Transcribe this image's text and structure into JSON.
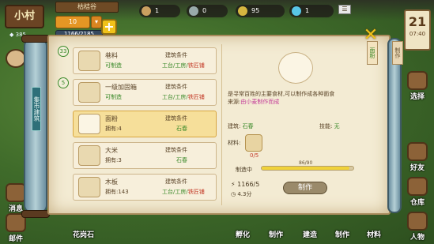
{
  "hud": {
    "village": "小村",
    "level": "385",
    "season": "枯桔谷",
    "orange_btn": "10",
    "progress": "1166/2185",
    "res1": "1",
    "res2": "0",
    "res3": "95",
    "res4": "1",
    "calendar_day": "21",
    "calendar_time": "07:40"
  },
  "side_right": [
    "背包",
    "选择",
    "好友",
    "仓库",
    "人物"
  ],
  "side_left": [
    "消息",
    "邮件"
  ],
  "bottom_nav": [
    "花岗石",
    "孵化",
    "制作",
    "建造",
    "制作",
    "材料",
    "人物"
  ],
  "scroll": {
    "vlabel": "集市建筑"
  },
  "list": [
    {
      "badge": "33",
      "name": "巷料",
      "status": "可制造",
      "cond_label": "建筑条件",
      "cond": "工台/工房/",
      "cond_red": "铁匠铺"
    },
    {
      "badge": "5",
      "name": "一级加固箱",
      "status": "可制造",
      "cond_label": "建筑条件",
      "cond": "工台/工房/",
      "cond_red": "铁匠铺"
    },
    {
      "badge": "",
      "name": "面粉",
      "status": "拥有:4",
      "cond_label": "建筑条件",
      "cond": "石春",
      "cond_red": ""
    },
    {
      "badge": "",
      "name": "大米",
      "status": "拥有:3",
      "cond_label": "建筑条件",
      "cond": "石春",
      "cond_red": ""
    },
    {
      "badge": "",
      "name": "木板",
      "status": "拥有:143",
      "cond_label": "建筑条件",
      "cond": "工台/工房/",
      "cond_red": "铁匠铺"
    }
  ],
  "detail": {
    "desc1": "是寻常百姓的主要食材,可以制作成各种面食",
    "desc2_prefix": "来源:",
    "desc2_link": "由小麦制作而成",
    "building_label": "建筑:",
    "building_val": "石春",
    "skill_label": "技能:",
    "skill_val": "无",
    "mat_label": "材料:",
    "mat_count": "0/5",
    "bar_label": "制造中",
    "bar_text": "86/90",
    "bar_fraction": 0.956,
    "cost": "1166/5",
    "time": "4.3分",
    "make_btn": "制作"
  },
  "tabs": [
    "面粉",
    "制作"
  ]
}
